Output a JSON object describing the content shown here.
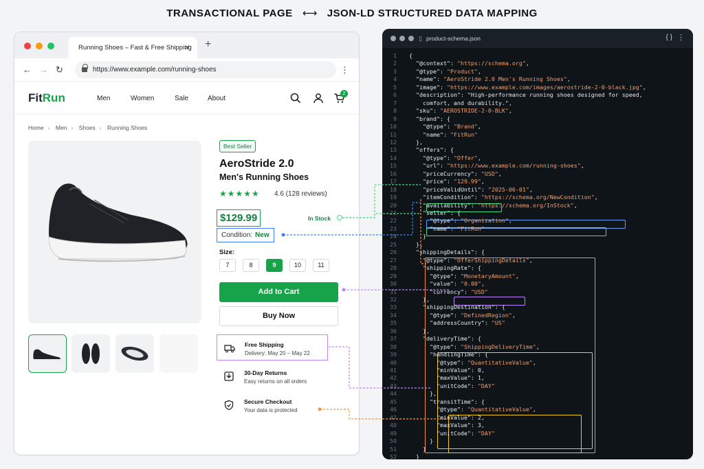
{
  "heading": {
    "left": "TRANSACTIONAL PAGE",
    "right": "JSON-LD STRUCTURED DATA MAPPING"
  },
  "browser": {
    "tab_title": "Running Shoes – Fast & Free Shipping",
    "url": "https://www.example.com/running-shoes"
  },
  "site": {
    "logo_fit": "Fit",
    "logo_run": "Run",
    "nav": [
      "Men",
      "Women",
      "Sale",
      "About"
    ],
    "cart_count": "2"
  },
  "breadcrumb": [
    "Home",
    "Men",
    "Shoes",
    "Running Shoes"
  ],
  "product": {
    "badge": "Best Seller",
    "title_line1": "AeroStride 2.0",
    "title_line2": "Men's Running Shoes",
    "stars": "★★★★★",
    "rating_text": "4.6 (128 reviews)",
    "price": "$129.99",
    "stock": "In Stock",
    "condition_label": "Condition:",
    "condition_value": "New",
    "size_label": "Size:",
    "sizes": [
      "7",
      "8",
      "9",
      "10",
      "11"
    ],
    "selected_size": "9",
    "add_to_cart": "Add to Cart",
    "buy_now": "Buy Now"
  },
  "features": [
    {
      "title": "Free Shipping",
      "sub": "Delivery: May 20 – May 22"
    },
    {
      "title": "30-Day Returns",
      "sub": "Easy returns on all orders"
    },
    {
      "title": "Secure Checkout",
      "sub": "Your data is protected"
    }
  ],
  "colors": {
    "brand": "#16a34a",
    "price_link": "#4ade80",
    "condition_link": "#3b82f6",
    "shipping_link": "#c084fc",
    "delivery_link": "#fb923c"
  },
  "editor": {
    "filename": "product-schema.json",
    "braces": "{ }",
    "lines": [
      "{",
      "  \"@context\": \"https://schema.org\",",
      "  \"@type\": \"Product\",",
      "  \"name\": \"AeroStride 2.0 Men's Running Shoes\",",
      "  \"image\": \"https://www.example.com/images/aerostride-2-0-black.jpg\",",
      "  \"description\": \"High-performance running shoes designed for speed,",
      "    comfort, and durability.\",",
      "  \"sku\": \"AEROSTRIDE-2-0-BLK\",",
      "  \"brand\": {",
      "    \"@type\": \"Brand\",",
      "    \"name\": \"FitRun\"",
      "  },",
      "  \"offers\": {",
      "    \"@type\": \"Offer\",",
      "    \"url\": \"https://www.example.com/running-shoes\",",
      "    \"priceCurrency\": \"USD\",",
      "    \"price\": \"129.99\",",
      "    \"priceValidUntil\": \"2025-06-01\",",
      "    \"itemCondition\": \"https://schema.org/NewCondition\",",
      "    \"availability\": \"https://schema.org/InStock\",",
      "    \"seller\": {",
      "      \"@type\": \"Organization\",",
      "      \"name\": \"FitRun\"",
      "    }",
      "  },",
      "  \"shippingDetails\": {",
      "    \"@type\": \"OfferShippingDetails\",",
      "    \"shippingRate\": {",
      "      \"@type\": \"MonetaryAmount\",",
      "      \"value\": \"0.00\",",
      "      \"currency\": \"USD\"",
      "    },",
      "    \"shippingDestination\": {",
      "      \"@type\": \"DefinedRegion\",",
      "      \"addressCountry\": \"US\"",
      "    },",
      "    \"deliveryTime\": {",
      "      \"@type\": \"ShippingDeliveryTime\",",
      "      \"handlingTime\": {",
      "        \"@type\": \"QuantitativeValue\",",
      "        \"minValue\": 0,",
      "        \"maxValue\": 1,",
      "        \"unitCode\": \"DAY\"",
      "      },",
      "      \"transitTime\": {",
      "        \"@type\": \"QuantitativeValue\",",
      "        \"minValue\": 2,",
      "        \"maxValue\": 3,",
      "        \"unitCode\": \"DAY\"",
      "      }",
      "    }",
      "  }",
      "}"
    ]
  }
}
